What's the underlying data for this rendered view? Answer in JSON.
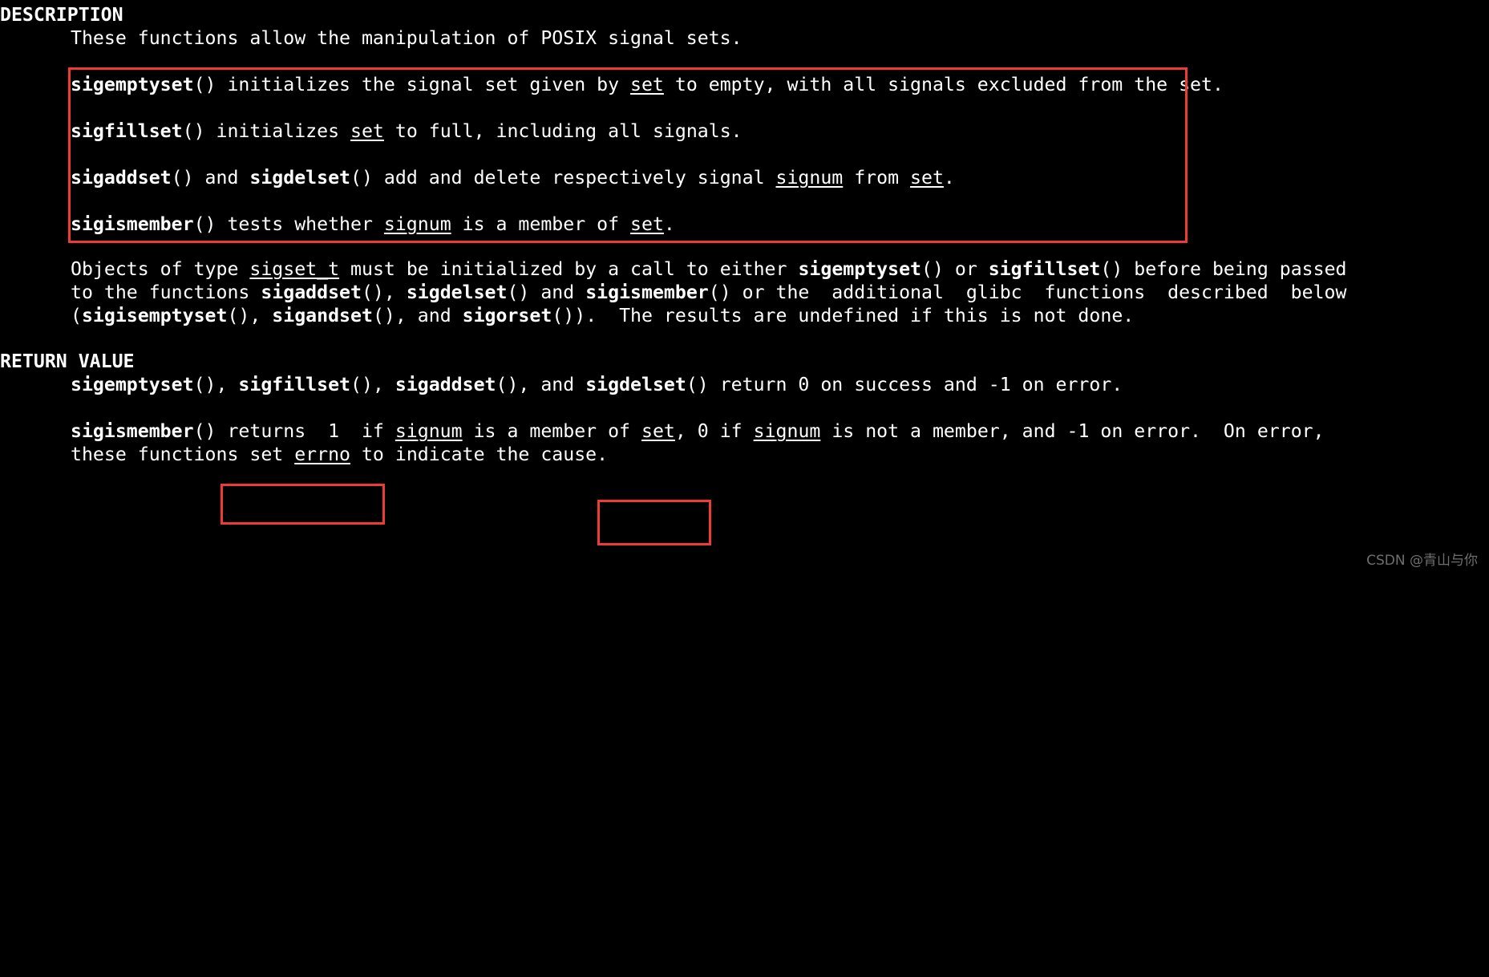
{
  "terminal": {
    "background_color": "#000000",
    "foreground_color": "#ffffff",
    "annotation_color": "#ef3b36"
  },
  "sections": {
    "description": {
      "heading": "DESCRIPTION",
      "intro": "These functions allow the manipulation of POSIX signal sets.",
      "boxed_lines": {
        "l1_a": "sigemptyset",
        "l1_b": "() initializes the signal set given by ",
        "l1_c": "set",
        "l1_d": " to empty, with all signals excluded from the set.",
        "l2_a": "sigfillset",
        "l2_b": "() initializes ",
        "l2_c": "set",
        "l2_d": " to full, including all signals.",
        "l3_a": "sigaddset",
        "l3_b": "() and ",
        "l3_c": "sigdelset",
        "l3_d": "() add and delete respectively signal ",
        "l3_e": "signum",
        "l3_f": " from ",
        "l3_g": "set",
        "l3_h": ".",
        "l4_a": "sigismember",
        "l4_b": "() tests whether ",
        "l4_c": "signum",
        "l4_d": " is a member of ",
        "l4_e": "set",
        "l4_f": "."
      },
      "objects_para": {
        "p1_a": "Objects of type ",
        "p1_b": "sigset_t",
        "p1_c": " must be initialized by a call to either ",
        "p1_d": "sigemptyset",
        "p1_e": "() or ",
        "p1_f": "sigfillset",
        "p1_g": "() before being passed",
        "p2_a": "to the functions ",
        "p2_b": "sigaddset",
        "p2_c": "(), ",
        "p2_d": "sigdelset",
        "p2_e": "() and ",
        "p2_f": "sigismember",
        "p2_g": "() or the  additional  glibc  functions  described  below",
        "p3_a": "(",
        "p3_b": "sigisemptyset",
        "p3_c": "(), ",
        "p3_d": "sigandset",
        "p3_e": "(), and ",
        "p3_f": "sigorset",
        "p3_g": "()).  The results are undefined if this is not done."
      }
    },
    "return_value": {
      "heading": "RETURN VALUE",
      "line1": {
        "a": "sigemptyset",
        "b": "(), ",
        "c": "sigfillset",
        "d": "(), ",
        "e": "sigaddset",
        "f": "(), and ",
        "g": "sigdelset",
        "h": "() return 0 on success and -1 on error."
      },
      "line2": {
        "a": "sigismember",
        "b": "() returns  1  if ",
        "c": "signum",
        "d": " is a member of ",
        "e": "set",
        "f": ", 0 if ",
        "g": "signum",
        "h": " is not a member, and -1 on error.  On error,"
      },
      "line3": {
        "a": "these functions set ",
        "b": "errno",
        "c": " to indicate the cause."
      }
    }
  },
  "annotations": {
    "main_box_label": "description-highlight-box",
    "returns_box_label": "returns-1-if-highlight-box",
    "setzero_box_label": "set-0-if-highlight-box"
  },
  "watermark": {
    "text": "CSDN @青山与你"
  }
}
